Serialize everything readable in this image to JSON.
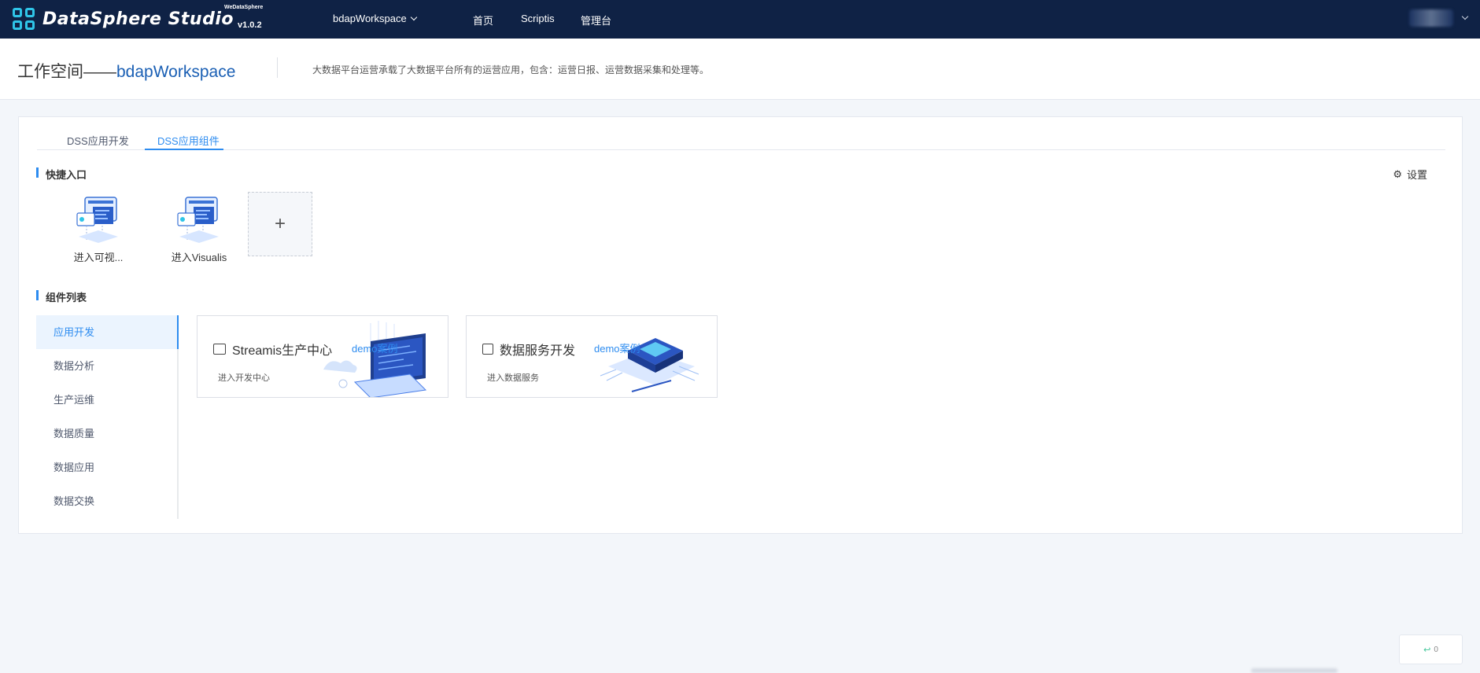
{
  "app": {
    "logo_text": "DataSphere Studio",
    "logo_superscript": "WeDataSphere",
    "version": "v1.0.2"
  },
  "nav": {
    "workspace_selector": "bdapWorkspace",
    "links": [
      "首页",
      "Scriptis",
      "管理台"
    ]
  },
  "header": {
    "title_prefix": "工作空间——",
    "workspace_name": "bdapWorkspace",
    "description": "大数据平台运营承载了大数据平台所有的运营应用，包含：运营日报、运营数据采集和处理等。"
  },
  "tabs": [
    {
      "label": "DSS应用开发",
      "active": false
    },
    {
      "label": "DSS应用组件",
      "active": true
    }
  ],
  "quick_entry": {
    "title": "快捷入口",
    "settings_label": "设置",
    "items": [
      {
        "label": "进入可视...",
        "icon": "visualization-icon"
      },
      {
        "label": "进入Visualis",
        "icon": "visualization-icon"
      }
    ],
    "add_label": "+"
  },
  "components": {
    "title": "组件列表",
    "menu": [
      {
        "label": "应用开发",
        "active": true
      },
      {
        "label": "数据分析",
        "active": false
      },
      {
        "label": "生产运维",
        "active": false
      },
      {
        "label": "数据质量",
        "active": false
      },
      {
        "label": "数据应用",
        "active": false
      },
      {
        "label": "数据交换",
        "active": false
      }
    ],
    "cards": [
      {
        "title": "Streamis生产中心",
        "subtitle": "进入开发中心",
        "demo": "demo案例",
        "icon": "code-window-icon"
      },
      {
        "title": "数据服务开发",
        "subtitle": "进入数据服务",
        "demo": "demo案例",
        "icon": "chip-icon"
      }
    ]
  },
  "float_widget": {
    "count": "0"
  },
  "colors": {
    "topbar": "#0f2245",
    "accent": "#2d8cf0",
    "logo_cyan": "#2fc5e8"
  }
}
